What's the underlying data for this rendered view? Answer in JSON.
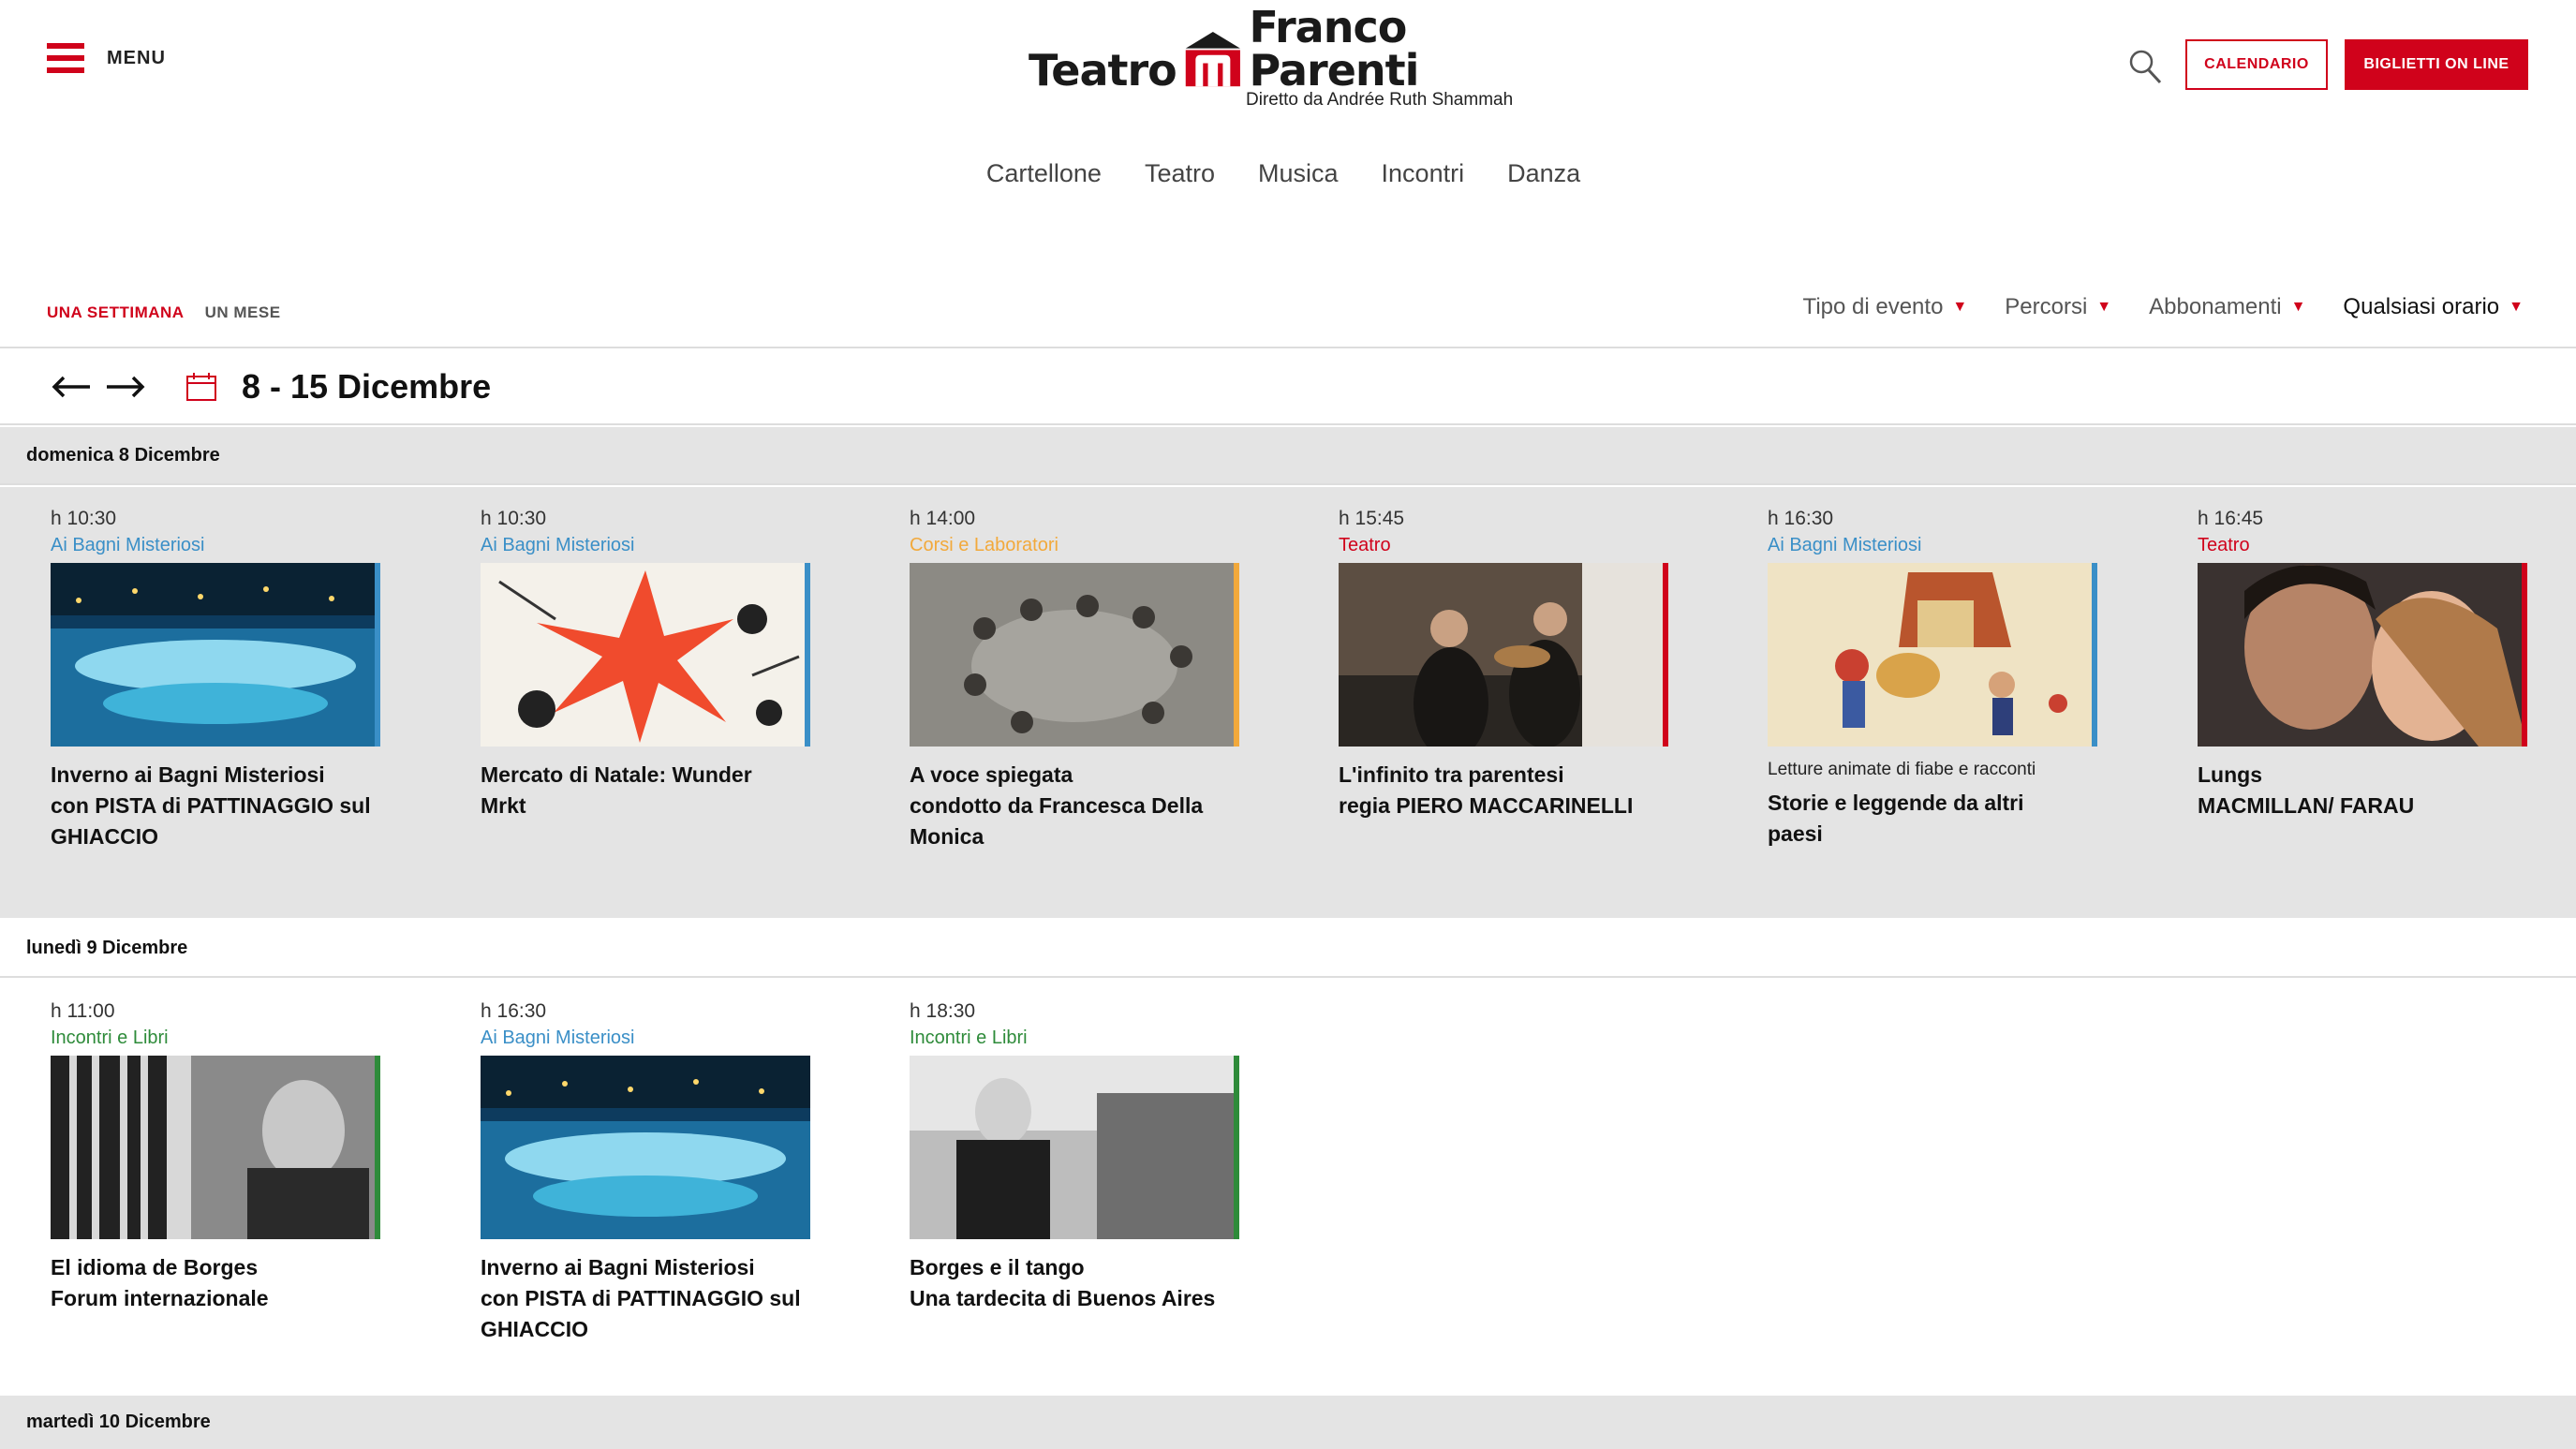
{
  "header": {
    "menu_label": "MENU",
    "logo": {
      "left": "Teatro",
      "right": "Franco Parenti",
      "subtitle": "Diretto da Andrée Ruth Shammah"
    },
    "calendar_button": "CALENDARIO",
    "tickets_button": "BIGLIETTI ON LINE"
  },
  "nav": [
    "Cartellone",
    "Teatro",
    "Musica",
    "Incontri",
    "Danza"
  ],
  "range_tabs": {
    "week": "UNA SETTIMANA",
    "month": "UN MESE"
  },
  "filters": [
    "Tipo di evento",
    "Percorsi",
    "Abbonamenti",
    "Qualsiasi orario"
  ],
  "week": "8 - 15 Dicembre",
  "days": [
    {
      "label": "domenica 8 Dicembre",
      "events": [
        {
          "time": "h 10:30",
          "category": "Ai Bagni Misteriosi",
          "pre": "",
          "title": "Inverno ai Bagni Misteriosi\ncon PISTA di PATTINAGGIO sul\nGHIACCIO"
        },
        {
          "time": "h 10:30",
          "category": "Ai Bagni Misteriosi",
          "pre": "",
          "title": "Mercato di Natale: Wunder\nMrkt"
        },
        {
          "time": "h 14:00",
          "category": "Corsi e Laboratori",
          "pre": "",
          "title": "A voce spiegata\ncondotto da Francesca Della\nMonica"
        },
        {
          "time": "h 15:45",
          "category": "Teatro",
          "pre": "",
          "title": "L'infinito tra parentesi\nregia PIERO MACCARINELLI"
        },
        {
          "time": "h 16:30",
          "category": "Ai Bagni Misteriosi",
          "pre": "Letture animate di fiabe e racconti",
          "title": "Storie e leggende da altri\npaesi"
        },
        {
          "time": "h 16:45",
          "category": "Teatro",
          "pre": "",
          "title": "Lungs\nMACMILLAN/ FARAU"
        }
      ]
    },
    {
      "label": "lunedì 9 Dicembre",
      "events": [
        {
          "time": "h 11:00",
          "category": "Incontri e Libri",
          "pre": "",
          "title": "El idioma de Borges\nForum internazionale"
        },
        {
          "time": "h 16:30",
          "category": "Ai Bagni Misteriosi",
          "pre": "",
          "title": "Inverno ai Bagni Misteriosi\ncon PISTA di PATTINAGGIO sul\nGHIACCIO"
        },
        {
          "time": "h 18:30",
          "category": "Incontri e Libri",
          "pre": "",
          "title": "Borges e il tango\nUna tardecita di Buenos Aires"
        }
      ]
    },
    {
      "label": "martedì 10 Dicembre",
      "events": []
    }
  ],
  "colors": {
    "brand_red": "#d0021b",
    "cat_bagni": "#3a8fc7",
    "cat_corsi": "#f2a93b",
    "cat_teatro": "#d0021b",
    "cat_incontri": "#2e8b3a",
    "day_grey": "#e4e4e4"
  }
}
